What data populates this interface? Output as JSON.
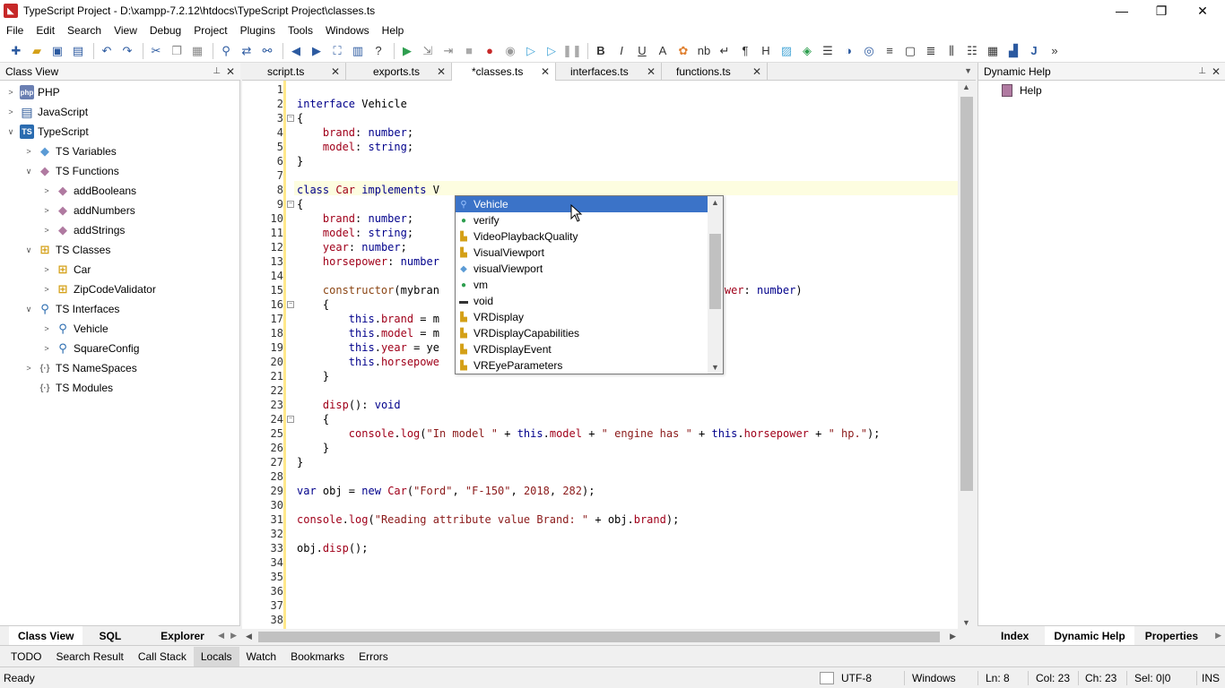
{
  "window": {
    "title": "TypeScript Project - D:\\xampp-7.2.12\\htdocs\\TypeScript Project\\classes.ts",
    "minimize": "—",
    "restore": "❐",
    "close": "✕"
  },
  "menu": [
    "File",
    "Edit",
    "Search",
    "View",
    "Debug",
    "Project",
    "Plugins",
    "Tools",
    "Windows",
    "Help"
  ],
  "class_view": {
    "title": "Class View",
    "pin": "📌",
    "close": "✕",
    "tree": [
      {
        "label": "PHP",
        "arrow": ">",
        "icon": "php"
      },
      {
        "label": "JavaScript",
        "arrow": ">",
        "icon": "js"
      },
      {
        "label": "TypeScript",
        "arrow": "∨",
        "icon": "ts"
      },
      {
        "label": "TS Variables",
        "arrow": ">",
        "icon": "var"
      },
      {
        "label": "TS Functions",
        "arrow": "∨",
        "icon": "fn"
      },
      {
        "label": "addBooleans",
        "arrow": ">",
        "icon": "fn"
      },
      {
        "label": "addNumbers",
        "arrow": ">",
        "icon": "fn"
      },
      {
        "label": "addStrings",
        "arrow": ">",
        "icon": "fn"
      },
      {
        "label": "TS Classes",
        "arrow": "∨",
        "icon": "cls"
      },
      {
        "label": "Car",
        "arrow": ">",
        "icon": "cls"
      },
      {
        "label": "ZipCodeValidator",
        "arrow": ">",
        "icon": "cls"
      },
      {
        "label": "TS Interfaces",
        "arrow": "∨",
        "icon": "ifc"
      },
      {
        "label": "Vehicle",
        "arrow": ">",
        "icon": "ifc"
      },
      {
        "label": "SquareConfig",
        "arrow": ">",
        "icon": "ifc"
      },
      {
        "label": "TS NameSpaces",
        "arrow": ">",
        "icon": "ns"
      },
      {
        "label": "TS Modules",
        "arrow": "",
        "icon": "ns"
      }
    ],
    "bottom_tabs": [
      "Class View",
      "SQL",
      "Explorer"
    ]
  },
  "editor": {
    "tabs": [
      {
        "label": "script.ts",
        "close": "✕"
      },
      {
        "label": "exports.ts",
        "close": "✕"
      },
      {
        "label": "*classes.ts",
        "close": "✕"
      },
      {
        "label": "interfaces.ts",
        "close": "✕"
      },
      {
        "label": "functions.ts",
        "close": "✕"
      }
    ],
    "line_numbers": [
      "1",
      "2",
      "3",
      "4",
      "5",
      "6",
      "7",
      "8",
      "9",
      "10",
      "11",
      "12",
      "13",
      "14",
      "15",
      "16",
      "17",
      "18",
      "19",
      "20",
      "21",
      "22",
      "23",
      "24",
      "25",
      "26",
      "27",
      "28",
      "29",
      "30",
      "31",
      "32",
      "33",
      "34",
      "35",
      "36",
      "37",
      "38"
    ]
  },
  "autocomplete": {
    "items": [
      {
        "label": "Vehicle",
        "icon": "interface-icon"
      },
      {
        "label": "verify",
        "icon": "function-icon"
      },
      {
        "label": "VideoPlaybackQuality",
        "icon": "class-icon"
      },
      {
        "label": "VisualViewport",
        "icon": "class-icon"
      },
      {
        "label": "visualViewport",
        "icon": "variable-icon"
      },
      {
        "label": "vm",
        "icon": "function-icon"
      },
      {
        "label": "void",
        "icon": "keyword-icon"
      },
      {
        "label": "VRDisplay",
        "icon": "class-icon"
      },
      {
        "label": "VRDisplayCapabilities",
        "icon": "class-icon"
      },
      {
        "label": "VRDisplayEvent",
        "icon": "class-icon"
      },
      {
        "label": "VREyeParameters",
        "icon": "class-icon"
      }
    ]
  },
  "dynamic_help": {
    "title": "Dynamic Help",
    "item": "Help",
    "bottom_tabs": [
      "Index",
      "Dynamic Help",
      "Properties"
    ]
  },
  "output_tabs": [
    "TODO",
    "Search Result",
    "Call Stack",
    "Locals",
    "Watch",
    "Bookmarks",
    "Errors"
  ],
  "status": {
    "ready": "Ready",
    "encoding": "UTF-8",
    "line_ending": "Windows",
    "line": "Ln: 8",
    "col": "Col: 23",
    "ch": "Ch: 23",
    "sel": "Sel: 0|0",
    "mode": "INS"
  }
}
